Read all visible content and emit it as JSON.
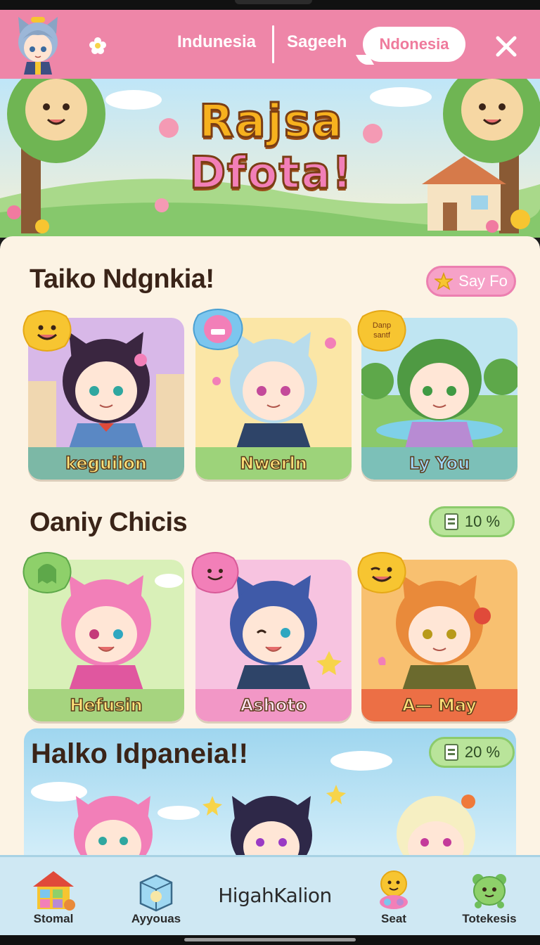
{
  "topnav": {
    "tabs": [
      "Indunesia",
      "Sageeh"
    ],
    "active_tab": "Ndonesia"
  },
  "hero": {
    "title_line1": "Rajsa",
    "title_line2": "Dfota!"
  },
  "sections": [
    {
      "title": "Taiko Ndgnkia!",
      "action": "Say Fo",
      "cards": [
        {
          "name": "keguiion",
          "label_color": "#7cb8a6",
          "bg": "#d8b8e8"
        },
        {
          "name": "Nwerln",
          "label_color": "#9dd37a",
          "bg": "#fbe6a6"
        },
        {
          "name": "Ly You",
          "label_color": "#7cc0b8",
          "bg": "#bfe5f2"
        }
      ]
    },
    {
      "title": "Oaniy Chicis",
      "action": "10 %",
      "cards": [
        {
          "name": "Hefusin",
          "label_color": "#a6d47f",
          "bg": "#d9f0b8"
        },
        {
          "name": "Ashoto",
          "label_color": "#f297c6",
          "bg": "#f7c3e0"
        },
        {
          "name": "A— May",
          "label_color": "#ec6f45",
          "bg": "#f8c070"
        }
      ]
    },
    {
      "title": "Halko Idpaneia!!",
      "action": "20 %"
    }
  ],
  "badges": {
    "card3_text": "Danp\nsantf"
  },
  "bottomnav": {
    "items": [
      "Stomal",
      "Ayyouas",
      "Seat",
      "Totekesis"
    ],
    "center_label": "HigahKalion"
  },
  "colors": {
    "nav_pink": "#ee86a8",
    "cream": "#fcf3e4",
    "bottom_blue": "#cfe8f3"
  }
}
